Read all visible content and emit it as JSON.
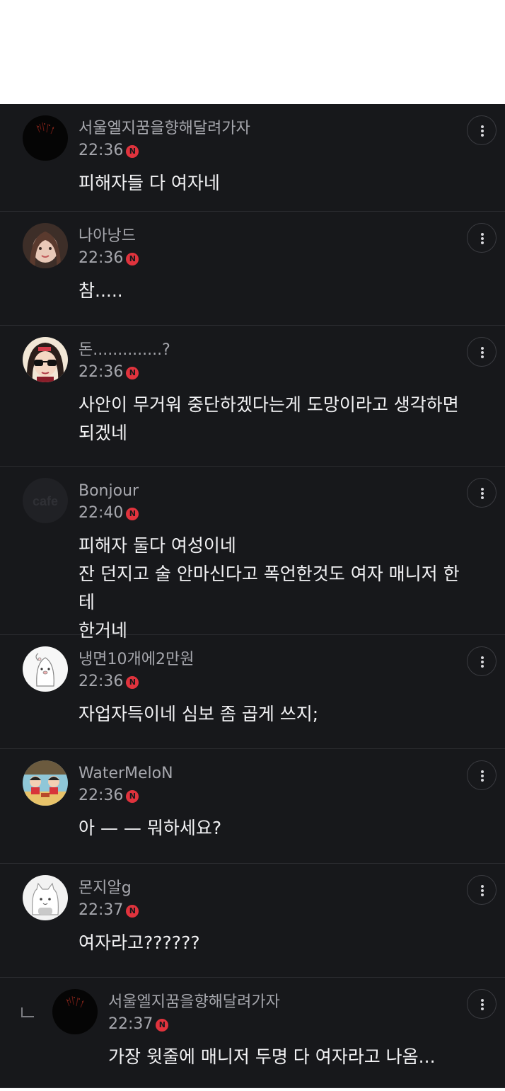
{
  "comments": [
    {
      "nickname": "서울엘지꿈을향해달려가자",
      "time": "22:36",
      "badge": "N",
      "lines": [
        "피해자들 다 여자네"
      ],
      "avatar": "dark-fireworks-avatar",
      "reply": false
    },
    {
      "nickname": "나아낭드",
      "time": "22:36",
      "badge": "N",
      "lines": [
        "참....."
      ],
      "avatar": "woman-photo-avatar",
      "reply": false
    },
    {
      "nickname": "돈..............?",
      "time": "22:36",
      "badge": "N",
      "lines": [
        "사안이 무거워 중단하겠다는게 도망이라고 생각하면",
        "되겠네"
      ],
      "avatar": "cartoon-girl-sunglasses-avatar",
      "reply": false
    },
    {
      "nickname": "Bonjour",
      "time": "22:40",
      "badge": "N",
      "lines": [
        "피해자 둘다 여성이네",
        "잔 던지고 술 안마신다고 폭언한것도 여자 매니저 한테",
        "한거네"
      ],
      "avatar": "cafe-default-avatar",
      "avatar_text": "cafe",
      "reply": false
    },
    {
      "nickname": "냉면10개에2만원",
      "time": "22:36",
      "badge": "N",
      "lines": [
        "자업자득이네 심보 좀 곱게 쓰지;"
      ],
      "avatar": "white-character-avatar",
      "reply": false
    },
    {
      "nickname": "WaterMeloN",
      "time": "22:36",
      "badge": "N",
      "lines": [
        "아 — — 뭐하세요?"
      ],
      "avatar": "cartoon-kids-avatar",
      "reply": false
    },
    {
      "nickname": "몬지알g",
      "time": "22:37",
      "badge": "N",
      "lines": [
        "여자라고??????"
      ],
      "avatar": "white-cat-avatar",
      "reply": false
    },
    {
      "nickname": "서울엘지꿈을향해달려가자",
      "time": "22:37",
      "badge": "N",
      "lines": [
        "가장 윗줄에 매니저 두명 다 여자라고 나옴..."
      ],
      "avatar": "dark-fireworks-avatar",
      "reply": true
    }
  ],
  "colors": {
    "background": "#17181b",
    "nickname": "#a6a7ad",
    "body": "#f2f2f4",
    "badge": "#e0333d",
    "divider": "#2b2c30"
  }
}
